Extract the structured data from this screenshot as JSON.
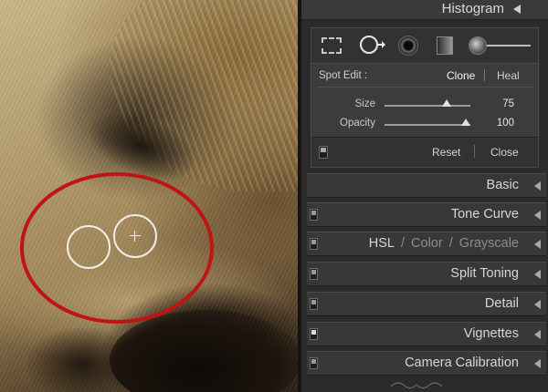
{
  "panel": {
    "histogram_title": "Histogram",
    "tools": [
      {
        "name": "crop-overlay-tool",
        "icon": "crop-icon"
      },
      {
        "name": "spot-removal-tool",
        "icon": "spot-removal-icon"
      },
      {
        "name": "red-eye-correction-tool",
        "icon": "red-eye-icon"
      },
      {
        "name": "graduated-filter-tool",
        "icon": "graduated-filter-icon"
      },
      {
        "name": "adjustment-brush-tool",
        "icon": "adjustment-brush-icon"
      }
    ],
    "spot_edit": {
      "label": "Spot Edit :",
      "clone_label": "Clone",
      "heal_label": "Heal",
      "selected_mode": "Clone",
      "size_label": "Size",
      "size_value": "75",
      "size_fraction": 0.72,
      "opacity_label": "Opacity",
      "opacity_value": "100",
      "opacity_fraction": 0.95
    },
    "footer": {
      "reset_label": "Reset",
      "close_label": "Close"
    },
    "sections": {
      "basic": "Basic",
      "tone_curve": "Tone Curve",
      "hsl": {
        "hsl": "HSL",
        "color": "Color",
        "grayscale": "Grayscale",
        "slash": "/"
      },
      "split_toning": "Split Toning",
      "detail": "Detail",
      "vignettes": "Vignettes",
      "camera_calibration": "Camera Calibration"
    }
  },
  "colors": {
    "annotation_circle": "#c01414",
    "panel_bg": "#2b2b2b",
    "section_bg": "#383838"
  }
}
